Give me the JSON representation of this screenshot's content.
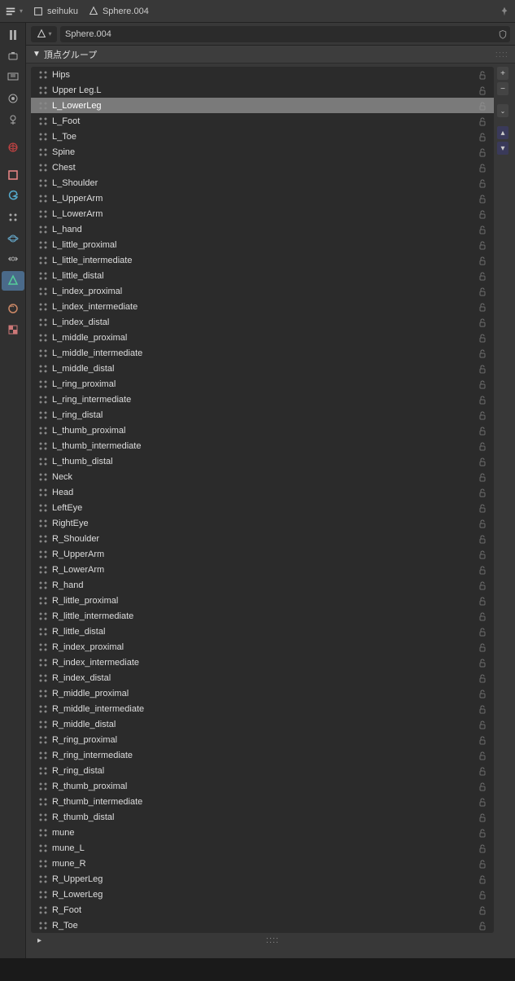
{
  "header": {
    "breadcrumb_mesh": "seihuku",
    "breadcrumb_obj": "Sphere.004",
    "search_value": "Sphere.004"
  },
  "panel": {
    "title": "頂点グループ"
  },
  "vertex_groups": [
    {
      "name": "Hips",
      "selected": false
    },
    {
      "name": "Upper Leg.L",
      "selected": false
    },
    {
      "name": "L_LowerLeg",
      "selected": true
    },
    {
      "name": "L_Foot",
      "selected": false
    },
    {
      "name": "L_Toe",
      "selected": false
    },
    {
      "name": "Spine",
      "selected": false
    },
    {
      "name": "Chest",
      "selected": false
    },
    {
      "name": "L_Shoulder",
      "selected": false
    },
    {
      "name": "L_UpperArm",
      "selected": false
    },
    {
      "name": "L_LowerArm",
      "selected": false
    },
    {
      "name": "L_hand",
      "selected": false
    },
    {
      "name": "L_little_proximal",
      "selected": false
    },
    {
      "name": "L_little_intermediate",
      "selected": false
    },
    {
      "name": "L_little_distal",
      "selected": false
    },
    {
      "name": "L_index_proximal",
      "selected": false
    },
    {
      "name": "L_index_intermediate",
      "selected": false
    },
    {
      "name": "L_index_distal",
      "selected": false
    },
    {
      "name": "L_middle_proximal",
      "selected": false
    },
    {
      "name": "L_middle_intermediate",
      "selected": false
    },
    {
      "name": "L_middle_distal",
      "selected": false
    },
    {
      "name": "L_ring_proximal",
      "selected": false
    },
    {
      "name": "L_ring_intermediate",
      "selected": false
    },
    {
      "name": "L_ring_distal",
      "selected": false
    },
    {
      "name": "L_thumb_proximal",
      "selected": false
    },
    {
      "name": "L_thumb_intermediate",
      "selected": false
    },
    {
      "name": "L_thumb_distal",
      "selected": false
    },
    {
      "name": "Neck",
      "selected": false
    },
    {
      "name": "Head",
      "selected": false
    },
    {
      "name": "LeftEye",
      "selected": false
    },
    {
      "name": "RightEye",
      "selected": false
    },
    {
      "name": "R_Shoulder",
      "selected": false
    },
    {
      "name": "R_UpperArm",
      "selected": false
    },
    {
      "name": "R_LowerArm",
      "selected": false
    },
    {
      "name": "R_hand",
      "selected": false
    },
    {
      "name": "R_little_proximal",
      "selected": false
    },
    {
      "name": "R_little_intermediate",
      "selected": false
    },
    {
      "name": "R_little_distal",
      "selected": false
    },
    {
      "name": "R_index_proximal",
      "selected": false
    },
    {
      "name": "R_index_intermediate",
      "selected": false
    },
    {
      "name": "R_index_distal",
      "selected": false
    },
    {
      "name": "R_middle_proximal",
      "selected": false
    },
    {
      "name": "R_middle_intermediate",
      "selected": false
    },
    {
      "name": "R_middle_distal",
      "selected": false
    },
    {
      "name": "R_ring_proximal",
      "selected": false
    },
    {
      "name": "R_ring_intermediate",
      "selected": false
    },
    {
      "name": "R_ring_distal",
      "selected": false
    },
    {
      "name": "R_thumb_proximal",
      "selected": false
    },
    {
      "name": "R_thumb_intermediate",
      "selected": false
    },
    {
      "name": "R_thumb_distal",
      "selected": false
    },
    {
      "name": "mune",
      "selected": false
    },
    {
      "name": "mune_L",
      "selected": false
    },
    {
      "name": "mune_R",
      "selected": false
    },
    {
      "name": "R_UpperLeg",
      "selected": false
    },
    {
      "name": "R_LowerLeg",
      "selected": false
    },
    {
      "name": "R_Foot",
      "selected": false
    },
    {
      "name": "R_Toe",
      "selected": false
    }
  ],
  "tool_tabs": [
    {
      "name": "tool",
      "color": "#aaa"
    },
    {
      "name": "render",
      "color": "#aaa"
    },
    {
      "name": "output",
      "color": "#aaa"
    },
    {
      "name": "viewlayer",
      "color": "#aaa"
    },
    {
      "name": "scene",
      "color": "#aaa"
    },
    {
      "name": "world",
      "color": "#c44"
    },
    {
      "name": "object",
      "color": "#e88"
    },
    {
      "name": "modifier",
      "color": "#5ac"
    },
    {
      "name": "particle",
      "color": "#aaa"
    },
    {
      "name": "physics",
      "color": "#6ac"
    },
    {
      "name": "constraint",
      "color": "#aaa"
    },
    {
      "name": "data",
      "color": "#5c9",
      "active": true
    },
    {
      "name": "material",
      "color": "#c86"
    },
    {
      "name": "texture",
      "color": "#c77"
    }
  ]
}
